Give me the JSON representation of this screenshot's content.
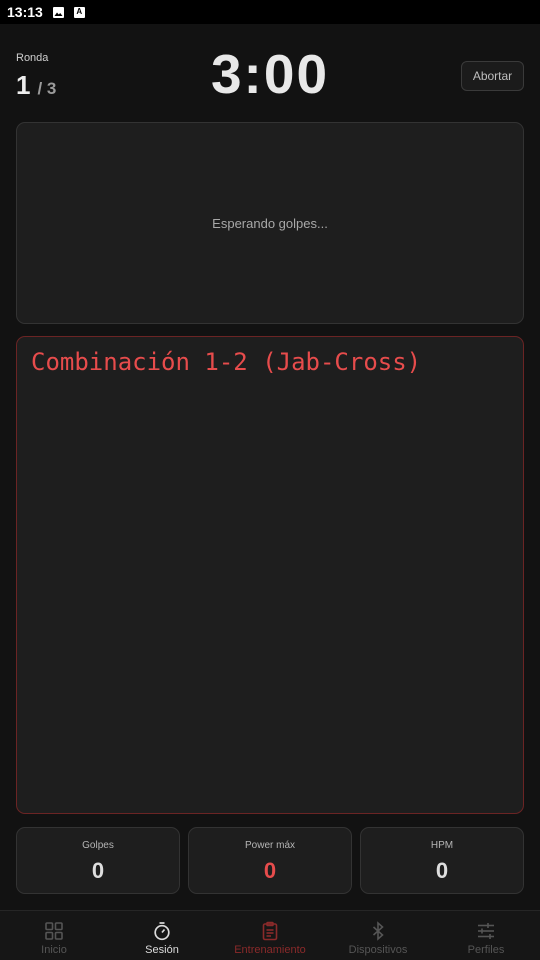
{
  "status_bar": {
    "time": "13:13",
    "icons": [
      "image-icon",
      "a-notification-icon"
    ]
  },
  "header": {
    "round_label": "Ronda",
    "round_current": "1",
    "round_total": "/ 3",
    "timer": "3:00",
    "abort_label": "Abortar"
  },
  "waiting_panel": {
    "text": "Esperando golpes..."
  },
  "combination": {
    "text": "Combinación 1-2 (Jab-Cross)",
    "color": "#e74c4c"
  },
  "stats": [
    {
      "label": "Golpes",
      "value": "0"
    },
    {
      "label": "Power máx",
      "value": "0"
    },
    {
      "label": "HPM",
      "value": "0"
    }
  ],
  "nav": [
    {
      "label": "Inicio",
      "icon": "grid-icon"
    },
    {
      "label": "Sesión",
      "icon": "stopwatch-icon"
    },
    {
      "label": "Entrenamiento",
      "icon": "clipboard-icon"
    },
    {
      "label": "Dispositivos",
      "icon": "bluetooth-icon"
    },
    {
      "label": "Perfiles",
      "icon": "sliders-icon"
    }
  ],
  "colors": {
    "accent_red": "#e74c4c",
    "background": "#121212",
    "panel": "#1e1e1e"
  }
}
